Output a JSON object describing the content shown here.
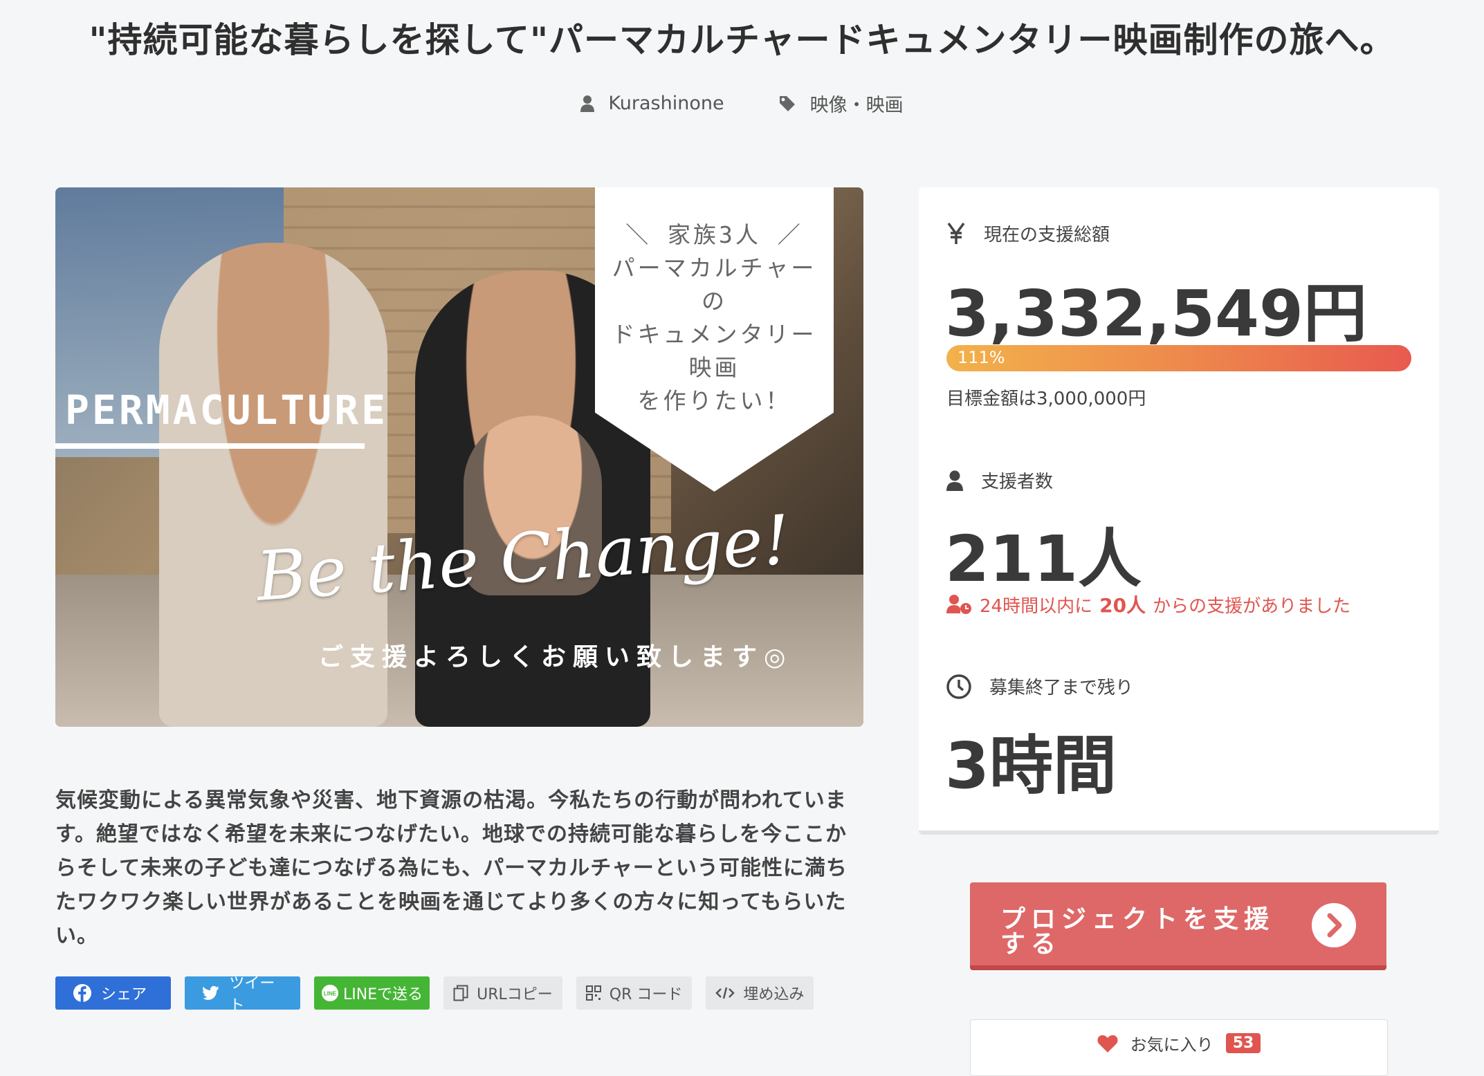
{
  "project": {
    "title": "\"持続可能な暮らしを探して\"パーマカルチャードキュメンタリー映画制作の旅へ。",
    "author": "Kurashinone",
    "category": "映像・映画"
  },
  "hero": {
    "banner_lines": [
      "＼ 家族3人 ／",
      "パーマカルチャー",
      "の",
      "ドキュメンタリー",
      "映画",
      "を作りたい！"
    ],
    "permaculture": "PERMACULTURE",
    "slogan": "Be the Change!",
    "request": "ご支援よろしくお願い致します◎"
  },
  "description": "気候変動による異常気象や災害、地下資源の枯渇。今私たちの行動が問われています。絶望ではなく希望を未来につなげたい。地球での持続可能な暮らしを今ここからそして未来の子ども達につなげる為にも、パーマカルチャーという可能性に満ちたワクワク楽しい世界があることを映画を通じてより多くの方々に知ってもらいたい。",
  "share": {
    "facebook": "シェア",
    "twitter": "ツイート",
    "line": "LINEで送る",
    "url_copy": "URLコピー",
    "qr": "QR コード",
    "embed": "埋め込み"
  },
  "stats": {
    "funding_label": "現在の支援総額",
    "funding_amount": "3,332,549円",
    "progress_text": "111%",
    "progress_fraction": 1.11,
    "goal": "目標金額は3,000,000円",
    "backers_label": "支援者数",
    "backers_count": "211人",
    "recent_prefix": "24時間以内に",
    "recent_count": "20人",
    "recent_suffix": "からの支援がありました",
    "remaining_label": "募集終了まで残り",
    "remaining": "3時間"
  },
  "actions": {
    "support_label": "プロジェクトを支援する",
    "favorite_label": "お気に入り",
    "favorite_count": "53"
  },
  "colors": {
    "accent": "#de6868",
    "alert": "#e0554f",
    "facebook": "#2f6fd8",
    "twitter": "#3b9be0",
    "line": "#45b535"
  }
}
